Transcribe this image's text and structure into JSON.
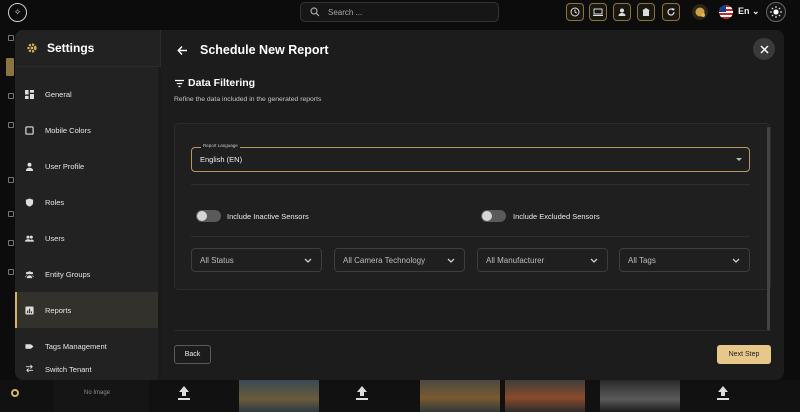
{
  "topbar": {
    "search_placeholder": "Search ...",
    "language": "En",
    "icons": [
      "clock-icon",
      "monitor-icon",
      "user-icon",
      "building-icon",
      "refresh-icon",
      "coin-icon",
      "flag-us-icon",
      "sun-icon"
    ]
  },
  "colors": {
    "accent": "#d9b35a",
    "next_button": "#e6c98a",
    "modal_bg": "#1c1c1c",
    "sidebar_bg": "#222222"
  },
  "settings": {
    "title": "Settings",
    "nav": [
      {
        "label": "General",
        "icon": "dashboard-icon",
        "active": false
      },
      {
        "label": "Mobile Colors",
        "icon": "mobile-icon",
        "active": false
      },
      {
        "label": "User Profile",
        "icon": "person-icon",
        "active": false
      },
      {
        "label": "Roles",
        "icon": "shield-icon",
        "active": false
      },
      {
        "label": "Users",
        "icon": "users-icon",
        "active": false
      },
      {
        "label": "Entity Groups",
        "icon": "group-icon",
        "active": false
      },
      {
        "label": "Reports",
        "icon": "report-icon",
        "active": true
      },
      {
        "label": "Tags Management",
        "icon": "tag-icon",
        "active": false
      },
      {
        "label": "Switch Tenant",
        "icon": "switch-icon",
        "active": false
      }
    ]
  },
  "report": {
    "title": "Schedule New Report",
    "section_title": "Data Filtering",
    "section_subtitle": "Refine the data included in the generated reports",
    "language_label": "Report Language",
    "language_value": "English (EN)",
    "toggle_inactive_label": "Include Inactive Sensors",
    "toggle_inactive_on": false,
    "toggle_excluded_label": "Include Excluded Sensors",
    "toggle_excluded_on": false,
    "filters": [
      "All Status",
      "All Camera Technology",
      "All Manufacturer",
      "All Tags"
    ],
    "back_label": "Back",
    "next_label": "Next Step"
  },
  "background": {
    "no_image_label": "No Image"
  }
}
